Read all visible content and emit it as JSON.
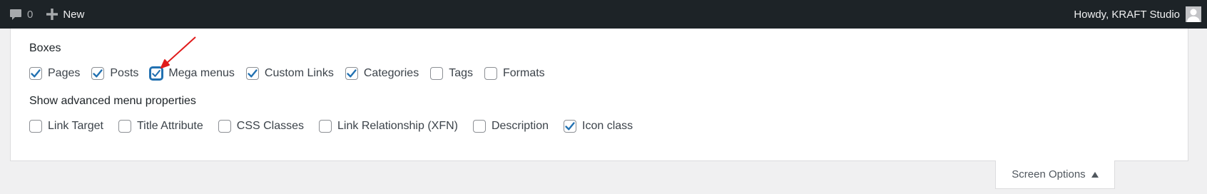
{
  "adminbar": {
    "comments_count": "0",
    "new_label": "New",
    "greeting": "Howdy, KRAFT Studio"
  },
  "boxes": {
    "title": "Boxes",
    "items": [
      {
        "label": "Pages",
        "checked": true
      },
      {
        "label": "Posts",
        "checked": true
      },
      {
        "label": "Mega menus",
        "checked": true
      },
      {
        "label": "Custom Links",
        "checked": true
      },
      {
        "label": "Categories",
        "checked": true
      },
      {
        "label": "Tags",
        "checked": false
      },
      {
        "label": "Formats",
        "checked": false
      }
    ]
  },
  "advanced": {
    "title": "Show advanced menu properties",
    "items": [
      {
        "label": "Link Target",
        "checked": false
      },
      {
        "label": "Title Attribute",
        "checked": false
      },
      {
        "label": "CSS Classes",
        "checked": false
      },
      {
        "label": "Link Relationship (XFN)",
        "checked": false
      },
      {
        "label": "Description",
        "checked": false
      },
      {
        "label": "Icon class",
        "checked": true
      }
    ]
  },
  "screen_options": {
    "label": "Screen Options"
  },
  "colors": {
    "adminbar_bg": "#1d2327",
    "accent": "#2271b1",
    "annotation_arrow": "#e01b1b"
  }
}
